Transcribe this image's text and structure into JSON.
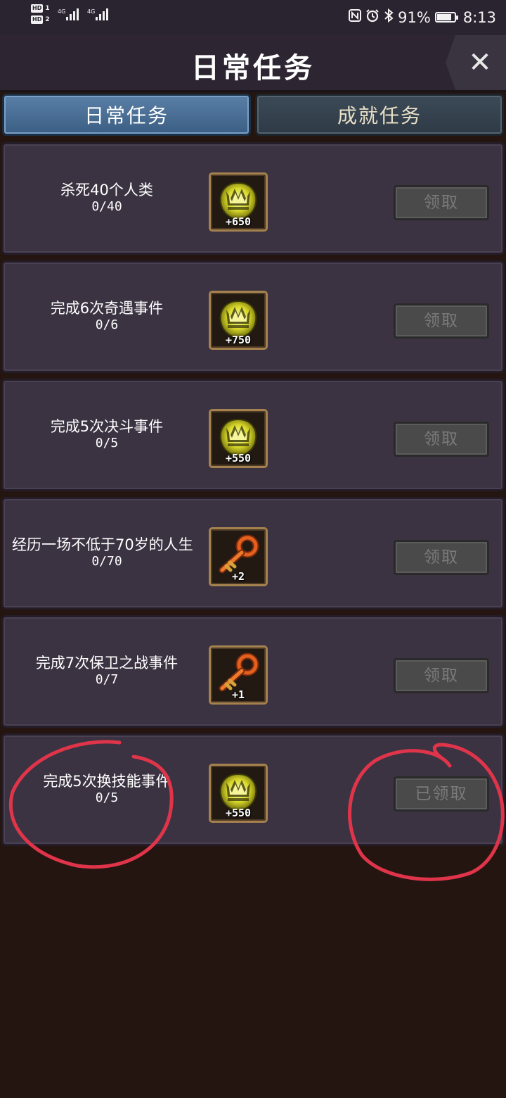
{
  "status_bar": {
    "sim1": "HD",
    "sim1_num": "1",
    "sim2": "HD",
    "sim2_num": "2",
    "net1": "4G",
    "net2": "4G",
    "battery": "91%",
    "battery_level": 0.91,
    "time": "8:13",
    "icons": [
      "nfc-icon",
      "alarm-icon",
      "bluetooth-icon"
    ]
  },
  "header": {
    "title": "日常任务",
    "close_label": "✕"
  },
  "tabs": [
    {
      "label": "日常任务",
      "active": true
    },
    {
      "label": "成就任务",
      "active": false
    }
  ],
  "tasks": [
    {
      "title": "杀死40个人类",
      "progress": "0/40",
      "reward_icon": "coin-icon",
      "reward_amount": "+650",
      "button": "领取"
    },
    {
      "title": "完成6次奇遇事件",
      "progress": "0/6",
      "reward_icon": "coin-icon",
      "reward_amount": "+750",
      "button": "领取"
    },
    {
      "title": "完成5次决斗事件",
      "progress": "0/5",
      "reward_icon": "coin-icon",
      "reward_amount": "+550",
      "button": "领取"
    },
    {
      "title": "经历一场不低于70岁的人生",
      "progress": "0/70",
      "reward_icon": "key-icon",
      "reward_amount": "+2",
      "button": "领取"
    },
    {
      "title": "完成7次保卫之战事件",
      "progress": "0/7",
      "reward_icon": "key-icon",
      "reward_amount": "+1",
      "button": "领取"
    },
    {
      "title": "完成5次换技能事件",
      "progress": "0/5",
      "reward_icon": "coin-icon",
      "reward_amount": "+550",
      "button": "已领取"
    }
  ],
  "colors": {
    "background": "#241511",
    "card": "#3b3342",
    "tab_active": "#4a6e95",
    "tab_inactive": "#35424f",
    "annotation": "#e0344a"
  }
}
